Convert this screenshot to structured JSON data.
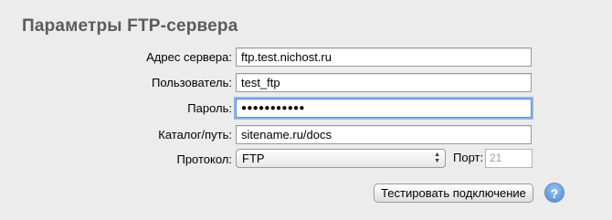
{
  "panel": {
    "title": "Параметры FTP-сервера"
  },
  "form": {
    "server_address": {
      "label": "Адрес сервера:",
      "value": "ftp.test.nichost.ru"
    },
    "username": {
      "label": "Пользователь:",
      "value": "test_ftp"
    },
    "password": {
      "label": "Пароль:",
      "value": "●●●●●●●●●●●"
    },
    "directory": {
      "label": "Каталог/путь:",
      "value": "sitename.ru/docs"
    },
    "protocol": {
      "label": "Протокол:",
      "value": "FTP"
    },
    "port": {
      "label": "Порт:",
      "placeholder": "21"
    }
  },
  "actions": {
    "test_connection": "Тестировать подключение",
    "help": "?"
  },
  "colors": {
    "focus_ring": "#8fb6ec",
    "help_button": "#4a86d2",
    "title_text": "#5b5b5b"
  }
}
